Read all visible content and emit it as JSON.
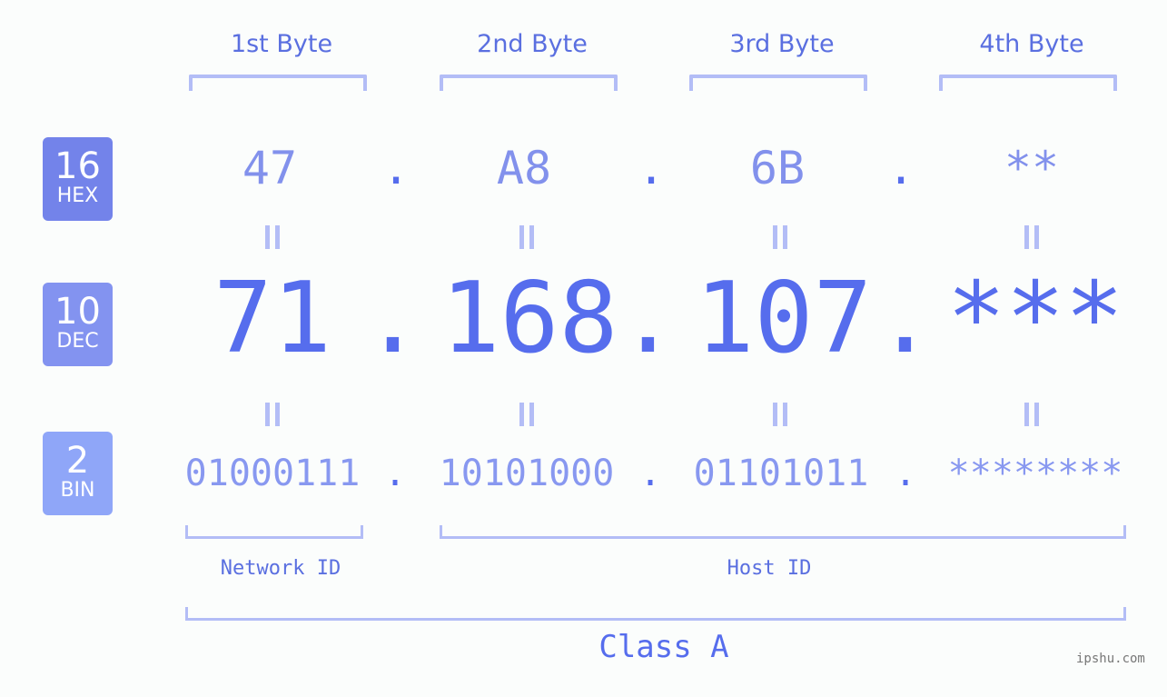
{
  "bytes": [
    {
      "label": "1st Byte",
      "hex": "47",
      "dec": "71",
      "bin": "01000111"
    },
    {
      "label": "2nd Byte",
      "hex": "A8",
      "dec": "168",
      "bin": "10101000"
    },
    {
      "label": "3rd Byte",
      "hex": "6B",
      "dec": "107",
      "bin": "01101011"
    },
    {
      "label": "4th Byte",
      "hex": "**",
      "dec": "***",
      "bin": "********"
    }
  ],
  "separator": ".",
  "badges": {
    "hex": {
      "num": "16",
      "label": "HEX",
      "color": "#7383ea"
    },
    "dec": {
      "num": "10",
      "label": "DEC",
      "color": "#8393f0"
    },
    "bin": {
      "num": "2",
      "label": "BIN",
      "color": "#8fa6f8"
    }
  },
  "segments": {
    "network": "Network ID",
    "host": "Host ID",
    "class": "Class A"
  },
  "watermark": "ipshu.com",
  "colors": {
    "primary": "#566ded",
    "bracket": "#b3bdf6"
  }
}
